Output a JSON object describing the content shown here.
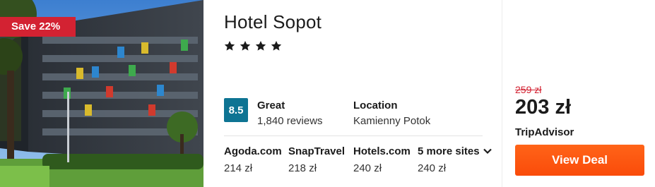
{
  "hotel": {
    "discount_badge": "Save 22%",
    "name": "Hotel Sopot",
    "stars": 4,
    "score": "8.5",
    "rating_word": "Great",
    "review_count": "1,840 reviews",
    "location_label": "Location",
    "location_value": "Kamienny Potok"
  },
  "sites": [
    {
      "name": "Agoda.com",
      "price": "214 zł"
    },
    {
      "name": "SnapTravel",
      "price": "218 zł"
    },
    {
      "name": "Hotels.com",
      "price": "240 zł"
    },
    {
      "name": "5 more sites",
      "price": "240 zł"
    }
  ],
  "deal": {
    "old_price": "259 zł",
    "price": "203 zł",
    "provider": "TripAdvisor",
    "button_label": "View Deal"
  },
  "colors": {
    "badge": "#d32232",
    "score_box": "#0e7493",
    "deal_button": "#ff5712",
    "old_price": "#d32232"
  },
  "icons": {
    "star": "star-icon",
    "chevron": "chevron-down-icon"
  }
}
